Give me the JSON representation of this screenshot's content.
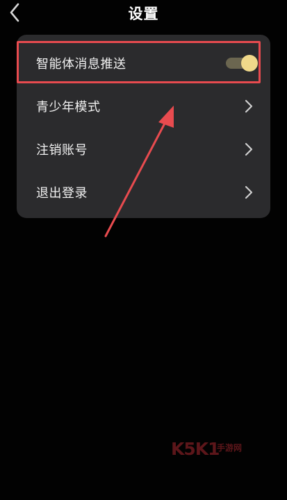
{
  "header": {
    "title": "设置",
    "back_icon": "chevron-left-icon"
  },
  "settings": {
    "items": [
      {
        "label": "智能体消息推送",
        "control": "toggle",
        "toggle_on": true
      },
      {
        "label": "青少年模式",
        "control": "chevron",
        "icon": "chevron-right-icon"
      },
      {
        "label": "注销账号",
        "control": "chevron",
        "icon": "chevron-right-icon"
      },
      {
        "label": "退出登录",
        "control": "chevron",
        "icon": "chevron-right-icon"
      }
    ]
  },
  "annotation": {
    "highlight_color": "#e84b4f",
    "arrow_color": "#e84b4f"
  },
  "watermark": {
    "logo": "K5K1",
    "text": "手游网"
  },
  "colors": {
    "background": "#020202",
    "card": "#2b2b2d",
    "toggle_thumb": "#f0d98a",
    "toggle_track": "#6b6650"
  }
}
